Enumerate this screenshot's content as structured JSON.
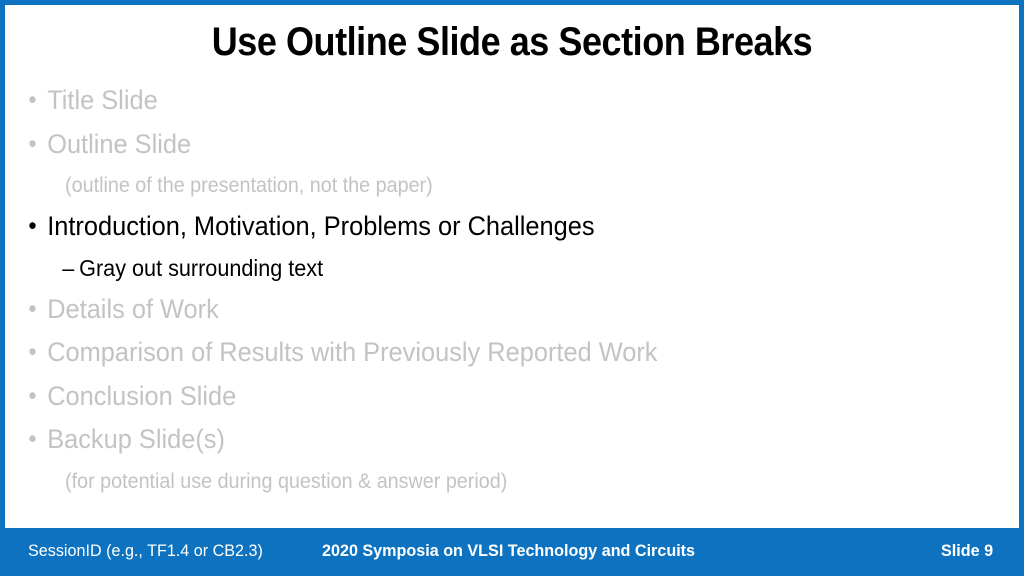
{
  "slide": {
    "title": "Use Outline Slide as Section Breaks",
    "accent_color": "#0d73c0",
    "dim_color": "#c3c3c3",
    "active_color": "#000000",
    "background_color": "#ffffff"
  },
  "outline": {
    "items": [
      {
        "level": 1,
        "text": "Title Slide",
        "state": "dim"
      },
      {
        "level": 1,
        "text": "Outline Slide",
        "state": "dim"
      },
      {
        "level": "note",
        "text": "(outline of the presentation, not the paper)",
        "state": "dim"
      },
      {
        "level": 1,
        "text": "Introduction, Motivation, Problems or Challenges",
        "state": "active"
      },
      {
        "level": 2,
        "text": "Gray out surrounding text",
        "state": "active"
      },
      {
        "level": 1,
        "text": "Details of Work",
        "state": "dim"
      },
      {
        "level": 1,
        "text": "Comparison of Results with Previously Reported Work",
        "state": "dim"
      },
      {
        "level": 1,
        "text": "Conclusion Slide",
        "state": "dim"
      },
      {
        "level": 1,
        "text": "Backup Slide(s)",
        "state": "dim"
      },
      {
        "level": "note",
        "text": "(for potential use during question & answer period)",
        "state": "dim"
      }
    ],
    "bullet_glyph": "•",
    "dash_glyph": "–"
  },
  "footer": {
    "session_id": "SessionID (e.g., TF1.4 or CB2.3)",
    "event": "2020 Symposia on VLSI Technology and Circuits",
    "slide_number": "Slide 9"
  }
}
